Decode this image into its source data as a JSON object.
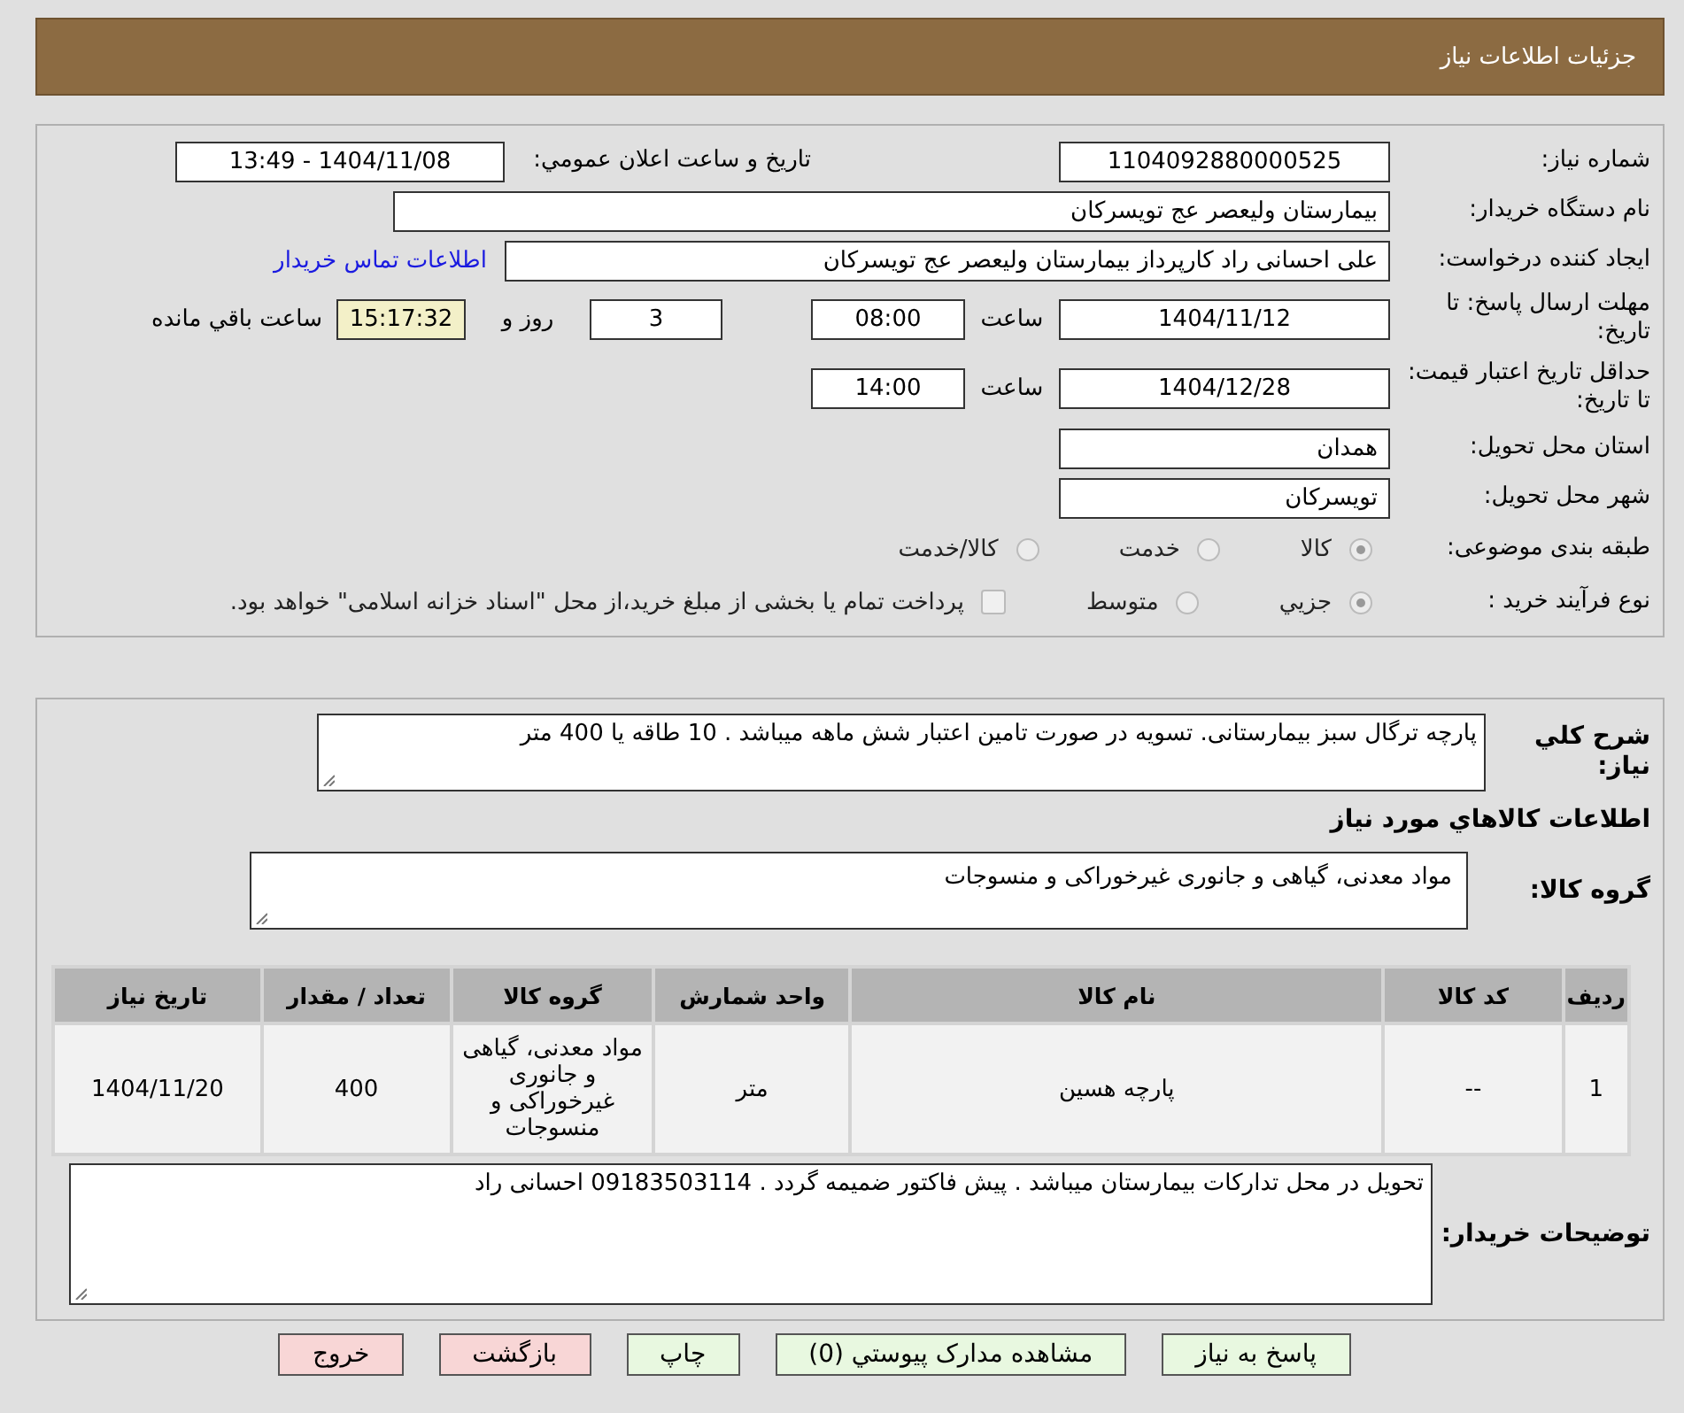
{
  "header": {
    "title": "جزئیات اطلاعات نیاز"
  },
  "details": {
    "need_number": {
      "label": "شماره نیاز:",
      "value": "1104092880000525"
    },
    "announce": {
      "label": "تاریخ و ساعت اعلان عمومي:",
      "value": "1404/11/08 - 13:49"
    },
    "buyer": {
      "label": "نام دستگاه خریدار:",
      "value": "بیمارستان ولیعصر  عج  تویسرکان"
    },
    "creator": {
      "label": "ایجاد کننده درخواست:",
      "value": "علی احسانی راد کارپرداز بیمارستان ولیعصر  عج  تویسرکان",
      "link": "اطلاعات تماس خریدار"
    },
    "deadline": {
      "label": "مهلت ارسال پاسخ: تا تاریخ:",
      "date": "1404/11/12",
      "time_label": "ساعت",
      "time": "08:00",
      "days": "3",
      "days_label": "روز و",
      "remaining": "15:17:32",
      "remaining_label": "ساعت باقي مانده"
    },
    "validity": {
      "label": "حداقل تاریخ اعتبار قیمت: تا تاریخ:",
      "date": "1404/12/28",
      "time_label": "ساعت",
      "time": "14:00"
    },
    "province": {
      "label": "استان محل تحویل:",
      "value": "همدان"
    },
    "city": {
      "label": "شهر محل تحویل:",
      "value": "تویسرکان"
    },
    "category": {
      "label": "طبقه بندی موضوعی:",
      "options": [
        {
          "label": "کالا",
          "selected": true
        },
        {
          "label": "خدمت",
          "selected": false
        },
        {
          "label": "کالا/خدمت",
          "selected": false
        }
      ]
    },
    "process": {
      "label": "نوع فرآیند خرید :",
      "options": [
        {
          "label": "جزيي",
          "selected": true
        },
        {
          "label": "متوسط",
          "selected": false
        }
      ],
      "treasury": {
        "checked": false,
        "text": "پرداخت تمام یا بخشی از مبلغ خرید،از محل \"اسناد خزانه اسلامی\" خواهد بود."
      }
    }
  },
  "description": {
    "label": "شرح کلي نیاز:",
    "value": "پارچه ترگال سبز  بیمارستانی. تسویه در صورت تامین اعتبار شش ماهه میباشد . 10 طاقه یا 400 متر"
  },
  "goods_heading": "اطلاعات کالاهاي مورد نیاز",
  "goods_group": {
    "label": "گروه کالا:",
    "value": "مواد معدنی، گیاهی و جانوری غیرخوراکی و منسوجات"
  },
  "table": {
    "columns": [
      "ردیف",
      "کد کالا",
      "نام کالا",
      "واحد شمارش",
      "گروه کالا",
      "تعداد / مقدار",
      "تاریخ نیاز"
    ],
    "rows": [
      [
        "1",
        "--",
        "پارچه هسین",
        "متر",
        "مواد معدنی، گیاهی و جانوری غیرخوراکی و منسوجات",
        "400",
        "1404/11/20"
      ]
    ]
  },
  "notes": {
    "label": "توضیحات خریدار:",
    "value": "تحویل در محل تدارکات بیمارستان میباشد . پیش فاکتور ضمیمه گردد . 09183503114 احسانی راد"
  },
  "buttons": [
    {
      "label": "پاسخ به نیاز",
      "kind": "action"
    },
    {
      "label": "مشاهده مدارک پیوستي (0)",
      "kind": "action"
    },
    {
      "label": "چاپ",
      "kind": "action"
    },
    {
      "label": "بازگشت",
      "kind": "exit"
    },
    {
      "label": "خروج",
      "kind": "exit"
    }
  ]
}
